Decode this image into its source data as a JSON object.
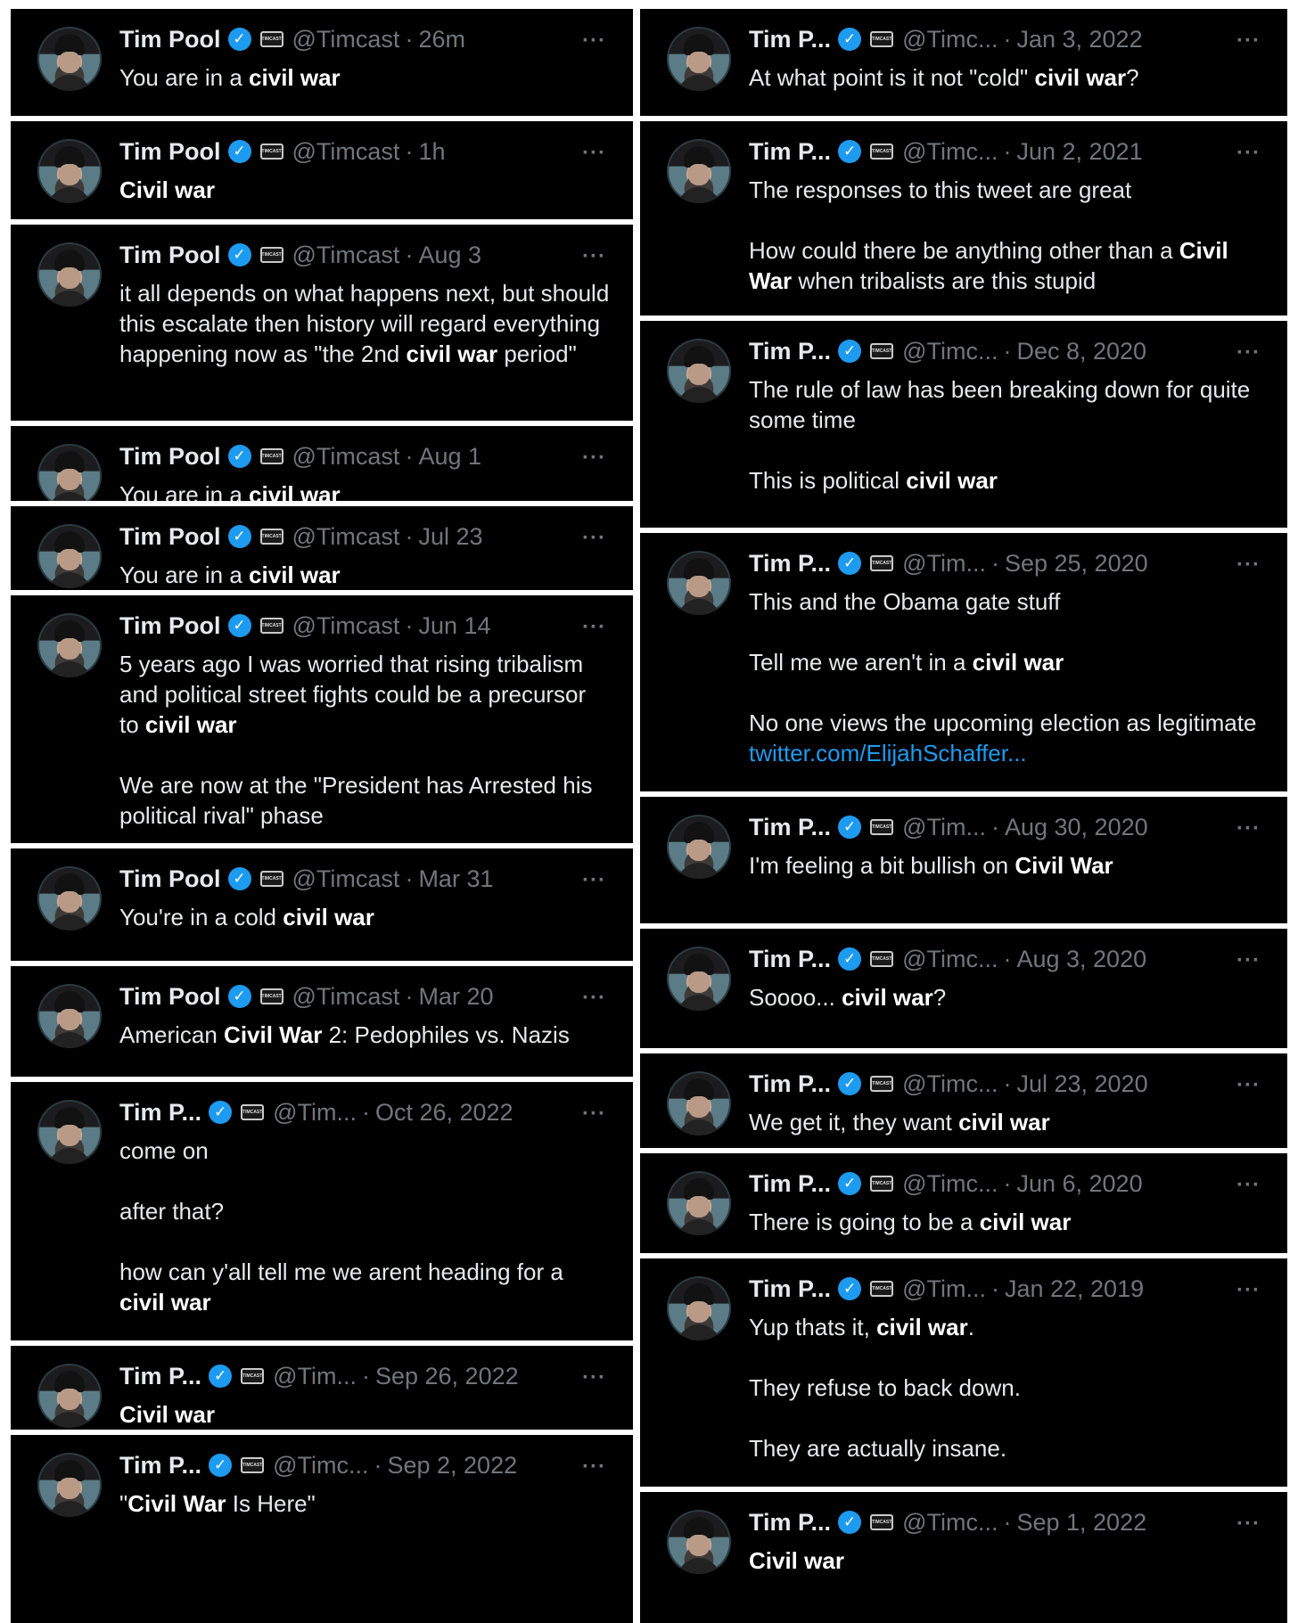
{
  "author": {
    "full_name": "Tim Pool",
    "short_name": "Tim P...",
    "verified_symbol": "✓",
    "badge_text": "TIMCAST"
  },
  "more_symbol": "···",
  "tweets": [
    {
      "name": "Tim Pool",
      "handle": "@Timcast",
      "time": "26m",
      "lines": [
        [
          {
            "t": "You are in a "
          },
          {
            "t": "civil war",
            "b": true
          }
        ]
      ]
    },
    {
      "name": "Tim Pool",
      "handle": "@Timcast",
      "time": "1h",
      "lines": [
        [
          {
            "t": "Civil war",
            "b": true
          }
        ]
      ]
    },
    {
      "name": "Tim Pool",
      "handle": "@Timcast",
      "time": "Aug 3",
      "lines": [
        [
          {
            "t": "it all depends on what happens next, but should this escalate then history will regard everything happening now as \"the 2nd "
          },
          {
            "t": "civil war",
            "b": true
          },
          {
            "t": " period\""
          }
        ]
      ]
    },
    {
      "name": "Tim Pool",
      "handle": "@Timcast",
      "time": "Aug 1",
      "lines": [
        [
          {
            "t": "You are in a "
          },
          {
            "t": "civil war",
            "b": true
          }
        ]
      ]
    },
    {
      "name": "Tim Pool",
      "handle": "@Timcast",
      "time": "Jul 23",
      "lines": [
        [
          {
            "t": "You are in a "
          },
          {
            "t": "civil war",
            "b": true
          }
        ]
      ]
    },
    {
      "name": "Tim Pool",
      "handle": "@Timcast",
      "time": "Jun 14",
      "lines": [
        [
          {
            "t": "5 years ago I was worried that rising tribalism and political street fights could be a precursor to "
          },
          {
            "t": "civil war",
            "b": true
          }
        ],
        [
          {
            "t": "We are now at the \"President has Arrested his political rival\" phase"
          }
        ]
      ]
    },
    {
      "name": "Tim Pool",
      "handle": "@Timcast",
      "time": "Mar 31",
      "lines": [
        [
          {
            "t": "You're in a cold "
          },
          {
            "t": "civil war",
            "b": true
          }
        ]
      ]
    },
    {
      "name": "Tim Pool",
      "handle": "@Timcast",
      "time": "Mar 20",
      "lines": [
        [
          {
            "t": "American "
          },
          {
            "t": "Civil War",
            "b": true
          },
          {
            "t": " 2: Pedophiles vs. Nazis"
          }
        ]
      ]
    },
    {
      "name": "Tim P...",
      "handle": "@Tim...",
      "time": "Oct 26, 2022",
      "lines": [
        [
          {
            "t": "come on"
          }
        ],
        [
          {
            "t": "after that?"
          }
        ],
        [
          {
            "t": "how can y'all tell me we arent heading for a "
          },
          {
            "t": "civil war",
            "b": true
          }
        ]
      ]
    },
    {
      "name": "Tim P...",
      "handle": "@Tim...",
      "time": "Sep 26, 2022",
      "lines": [
        [
          {
            "t": "Civil war",
            "b": true
          }
        ]
      ]
    },
    {
      "name": "Tim P...",
      "handle": "@Timc...",
      "time": "Sep 2, 2022",
      "lines": [
        [
          {
            "t": "\""
          },
          {
            "t": "Civil War",
            "b": true
          },
          {
            "t": " Is Here\""
          }
        ]
      ]
    },
    {
      "name": "Tim P...",
      "handle": "@Timc...",
      "time": "Jan 3, 2022",
      "lines": [
        [
          {
            "t": "At what point is it not \"cold\" "
          },
          {
            "t": "civil war",
            "b": true
          },
          {
            "t": "?"
          }
        ]
      ]
    },
    {
      "name": "Tim P...",
      "handle": "@Timc...",
      "time": "Jun 2, 2021",
      "lines": [
        [
          {
            "t": "The responses to this tweet are great"
          }
        ],
        [
          {
            "t": "How could there be anything other than a "
          },
          {
            "t": "Civil War",
            "b": true
          },
          {
            "t": " when tribalists are this stupid"
          }
        ]
      ]
    },
    {
      "name": "Tim P...",
      "handle": "@Timc...",
      "time": "Dec 8, 2020",
      "lines": [
        [
          {
            "t": "The rule of law has been breaking down for quite some time"
          }
        ],
        [
          {
            "t": "This is political "
          },
          {
            "t": "civil war",
            "b": true
          }
        ]
      ]
    },
    {
      "name": "Tim P...",
      "handle": "@Tim...",
      "time": "Sep 25, 2020",
      "lines": [
        [
          {
            "t": "This and the Obama gate stuff"
          }
        ],
        [
          {
            "t": "Tell me we aren't in a "
          },
          {
            "t": "civil war",
            "b": true
          }
        ],
        [
          {
            "t": "No one views the upcoming election as legitimate "
          },
          {
            "t": "twitter.com/ElijahSchaffer...",
            "link": true
          }
        ]
      ]
    },
    {
      "name": "Tim P...",
      "handle": "@Tim...",
      "time": "Aug 30, 2020",
      "lines": [
        [
          {
            "t": "I'm feeling a bit bullish on "
          },
          {
            "t": "Civil War",
            "b": true
          }
        ]
      ]
    },
    {
      "name": "Tim P...",
      "handle": "@Timc...",
      "time": "Aug 3, 2020",
      "lines": [
        [
          {
            "t": "Soooo... "
          },
          {
            "t": "civil war",
            "b": true
          },
          {
            "t": "?"
          }
        ]
      ]
    },
    {
      "name": "Tim P...",
      "handle": "@Timc...",
      "time": "Jul 23, 2020",
      "lines": [
        [
          {
            "t": "We get it, they want "
          },
          {
            "t": "civil war",
            "b": true
          }
        ]
      ]
    },
    {
      "name": "Tim P...",
      "handle": "@Timc...",
      "time": "Jun 6, 2020",
      "lines": [
        [
          {
            "t": "There is going to be a "
          },
          {
            "t": "civil war",
            "b": true
          }
        ]
      ]
    },
    {
      "name": "Tim P...",
      "handle": "@Tim...",
      "time": "Jan 22, 2019",
      "lines": [
        [
          {
            "t": "Yup thats it, "
          },
          {
            "t": "civil war",
            "b": true
          },
          {
            "t": "."
          }
        ],
        [
          {
            "t": "They refuse to back down."
          }
        ],
        [
          {
            "t": "They are actually insane."
          }
        ]
      ]
    },
    {
      "name": "Tim P...",
      "handle": "@Timc...",
      "time": "Sep 1, 2022",
      "lines": [
        [
          {
            "t": "Civil war",
            "b": true
          }
        ]
      ]
    }
  ]
}
